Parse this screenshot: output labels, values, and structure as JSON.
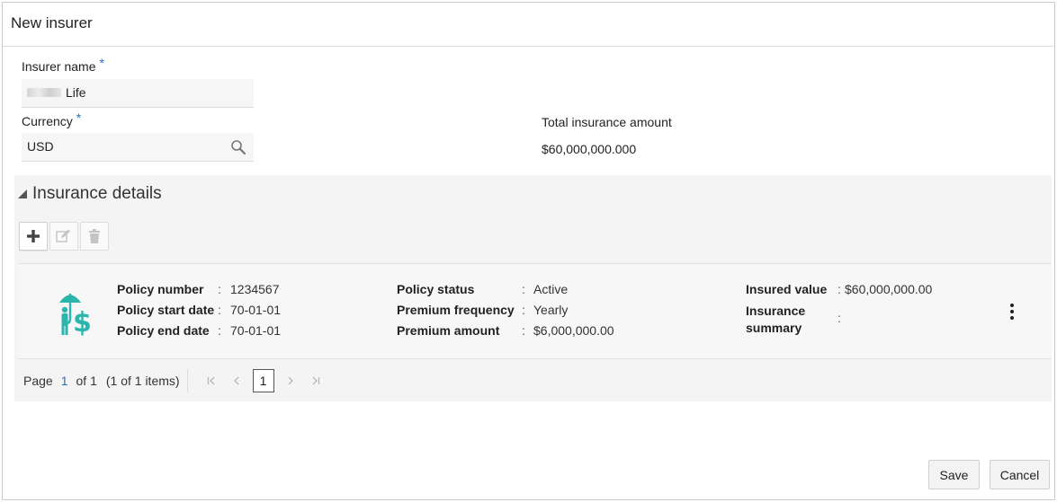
{
  "header": {
    "title": "New insurer"
  },
  "form": {
    "insurer_name_label": "Insurer name",
    "required_mark": "*",
    "insurer_name_value": "Life",
    "currency_label": "Currency",
    "currency_value": "USD",
    "total_label": "Total insurance amount",
    "total_value": "$60,000,000.000"
  },
  "insurance_details": {
    "title": "Insurance details",
    "toolbar": {
      "add_icon": "plus-icon",
      "edit_icon": "edit-icon",
      "delete_icon": "trash-icon"
    },
    "record": {
      "icon": "umbrella-dollar-icon",
      "policy_number_label": "Policy number",
      "policy_number_value": "1234567",
      "policy_start_label": "Policy start date",
      "policy_start_value": "70-01-01",
      "policy_end_label": "Policy end date",
      "policy_end_value": "70-01-01",
      "policy_status_label": "Policy status",
      "policy_status_value": "Active",
      "premium_frequency_label": "Premium frequency",
      "premium_frequency_value": "Yearly",
      "premium_amount_label": "Premium amount",
      "premium_amount_value": "$6,000,000.00",
      "insured_value_label": "Insured value",
      "insured_value_value": "$60,000,000.00",
      "insurance_summary_label_line1": "Insurance",
      "insurance_summary_label_line2": "summary",
      "insurance_summary_value": "",
      "separator": ":"
    },
    "pager": {
      "page_label": "Page",
      "current_page": "1",
      "of_label": "of 1",
      "items_label": "(1 of 1 items)",
      "page_box": "1"
    }
  },
  "footer": {
    "save_label": "Save",
    "cancel_label": "Cancel"
  },
  "colors": {
    "accent": "#2a6ebb",
    "icon_teal": "#2bb5ac"
  }
}
